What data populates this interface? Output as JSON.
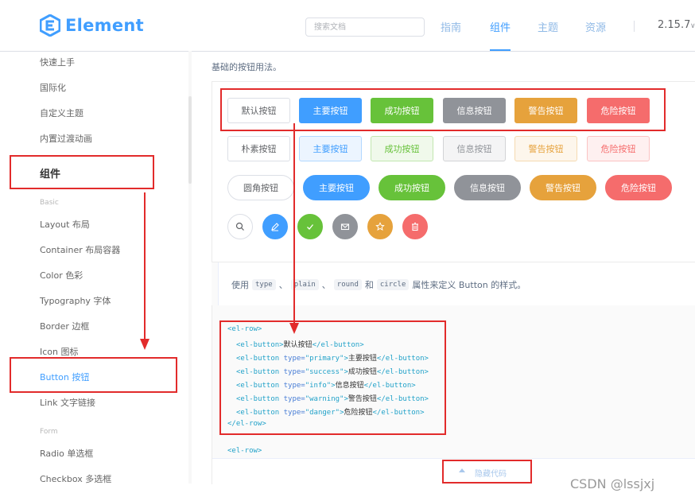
{
  "header": {
    "brand": "Element",
    "search_placeholder": "搜索文档",
    "nav": [
      "指南",
      "组件",
      "主题",
      "资源"
    ],
    "version": "2.15.7",
    "version_caret": "∨"
  },
  "sidebar": {
    "items_top": [
      "快速上手",
      "国际化",
      "自定义主题",
      "内置过渡动画"
    ],
    "group": "组件",
    "sub_basic": "Basic",
    "basic_items": [
      "Layout 布局",
      "Container 布局容器",
      "Color 色彩",
      "Typography 字体",
      "Border 边框",
      "Icon 图标",
      "Button 按钮",
      "Link 文字链接"
    ],
    "sub_form": "Form",
    "form_items": [
      "Radio 单选框",
      "Checkbox 多选框"
    ]
  },
  "content": {
    "intro": "基础的按钮用法。",
    "row_default": [
      "默认按钮",
      "主要按钮",
      "成功按钮",
      "信息按钮",
      "警告按钮",
      "危险按钮"
    ],
    "row_plain": [
      "朴素按钮",
      "主要按钮",
      "成功按钮",
      "信息按钮",
      "警告按钮",
      "危险按钮"
    ],
    "row_round": [
      "圆角按钮",
      "主要按钮",
      "成功按钮",
      "信息按钮",
      "警告按钮",
      "危险按钮"
    ],
    "circle_icons": [
      "search-icon",
      "edit-icon",
      "check-icon",
      "message-icon",
      "star-icon",
      "delete-icon"
    ],
    "description": {
      "prefix": "使用",
      "type": "type",
      "sep1": "、",
      "plain": "plain",
      "sep2": "、",
      "round": "round",
      "and": "和",
      "circle": "circle",
      "suffix": "属性来定义 Button 的样式。"
    },
    "code": {
      "row_open": "<el-row>",
      "btn_open": "<el-button>",
      "btn_close": "</el-button>",
      "default_text": "默认按钮",
      "attr_type": "type=",
      "types": [
        "\"primary\"",
        "\"success\"",
        "\"info\"",
        "\"warning\"",
        "\"danger\""
      ],
      "type_texts": [
        "主要按钮",
        "成功按钮",
        "信息按钮",
        "警告按钮",
        "危险按钮"
      ],
      "row_close": "</el-row>",
      "btn_prefix": "<el-button ",
      "gt": ">"
    },
    "hide_code": "隐藏代码"
  },
  "watermark": "CSDN @lssjxj",
  "colors": {
    "primary": "#409eff",
    "success": "#67c23a",
    "info": "#909399",
    "warning": "#e6a23c",
    "danger": "#f56c6c",
    "annotation": "#e22b2b"
  }
}
